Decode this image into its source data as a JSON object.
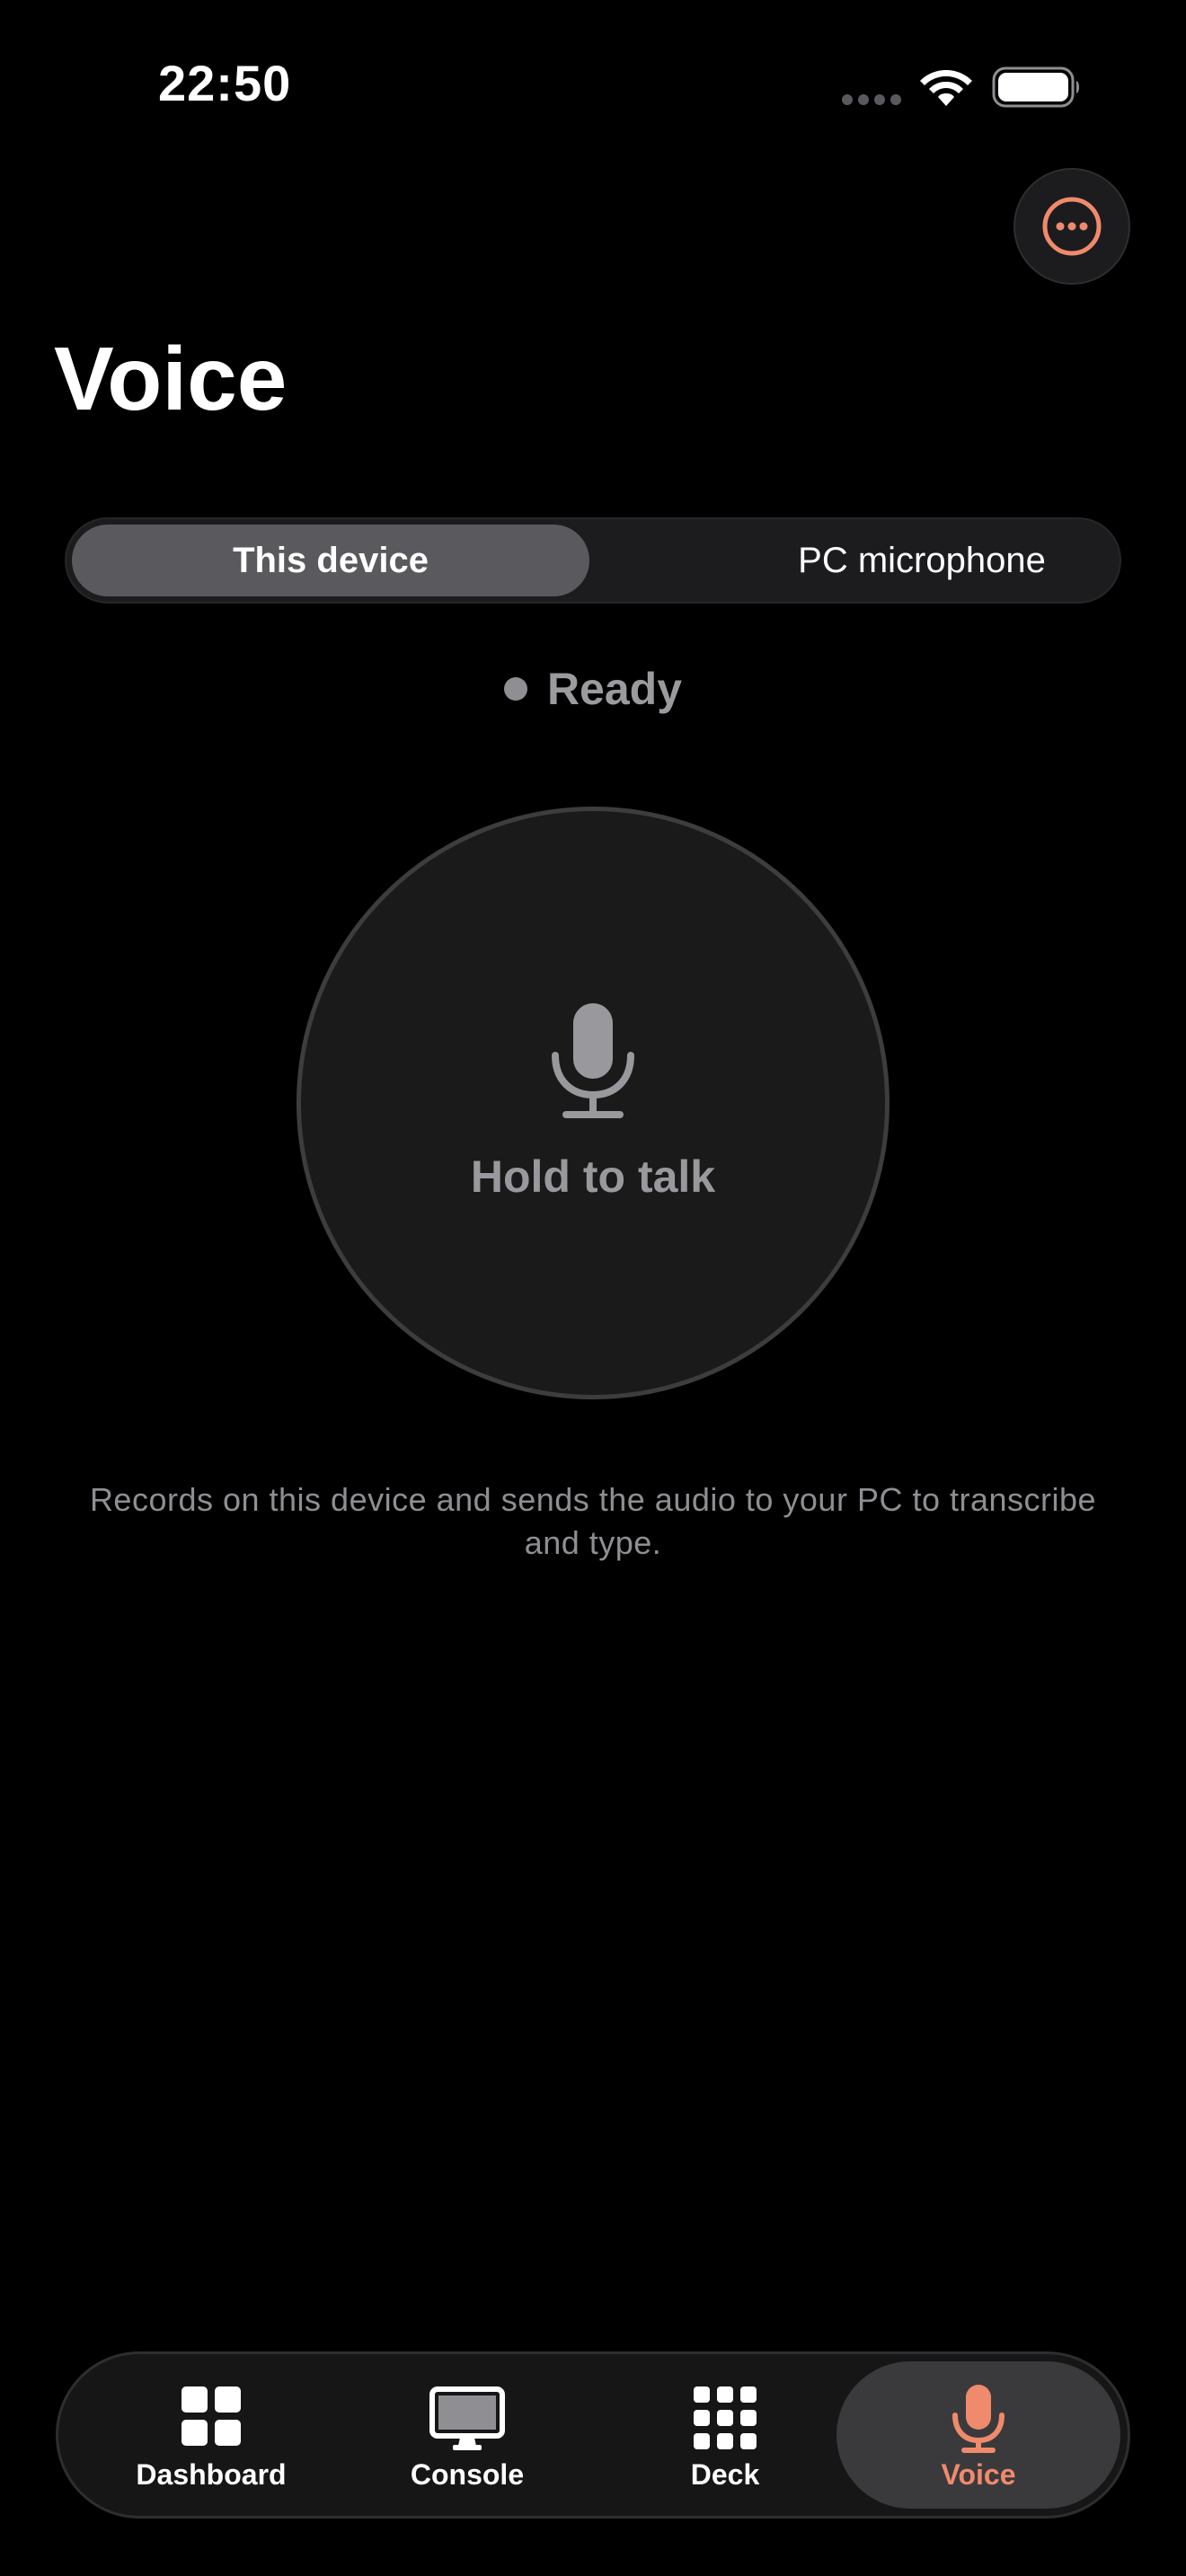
{
  "status_bar": {
    "time": "22:50",
    "signal_icon": "cellular-dots-icon",
    "wifi_icon": "wifi-icon",
    "battery_icon": "battery-full-icon"
  },
  "header": {
    "more_icon": "ellipsis-circle-icon",
    "title": "Voice"
  },
  "source_selector": {
    "options": [
      "This device",
      "PC microphone"
    ],
    "selected": "This device"
  },
  "status": {
    "text": "Ready",
    "dot_color": "#8e8e93"
  },
  "talk_button": {
    "icon": "microphone-icon",
    "label": "Hold to talk"
  },
  "description": "Records on this device and sends the audio to your PC to transcribe and type.",
  "tab_bar": {
    "tabs": [
      {
        "label": "Dashboard",
        "icon": "dashboard-grid-icon"
      },
      {
        "label": "Console",
        "icon": "monitor-icon"
      },
      {
        "label": "Deck",
        "icon": "deck-grid-icon"
      },
      {
        "label": "Voice",
        "icon": "microphone-icon"
      }
    ],
    "active": "Voice"
  },
  "colors": {
    "accent": "#f08a6c",
    "background": "#000000",
    "surface": "#1c1c1e",
    "selected_segment": "#5a5a5e",
    "secondary_text": "#8e8e93"
  }
}
